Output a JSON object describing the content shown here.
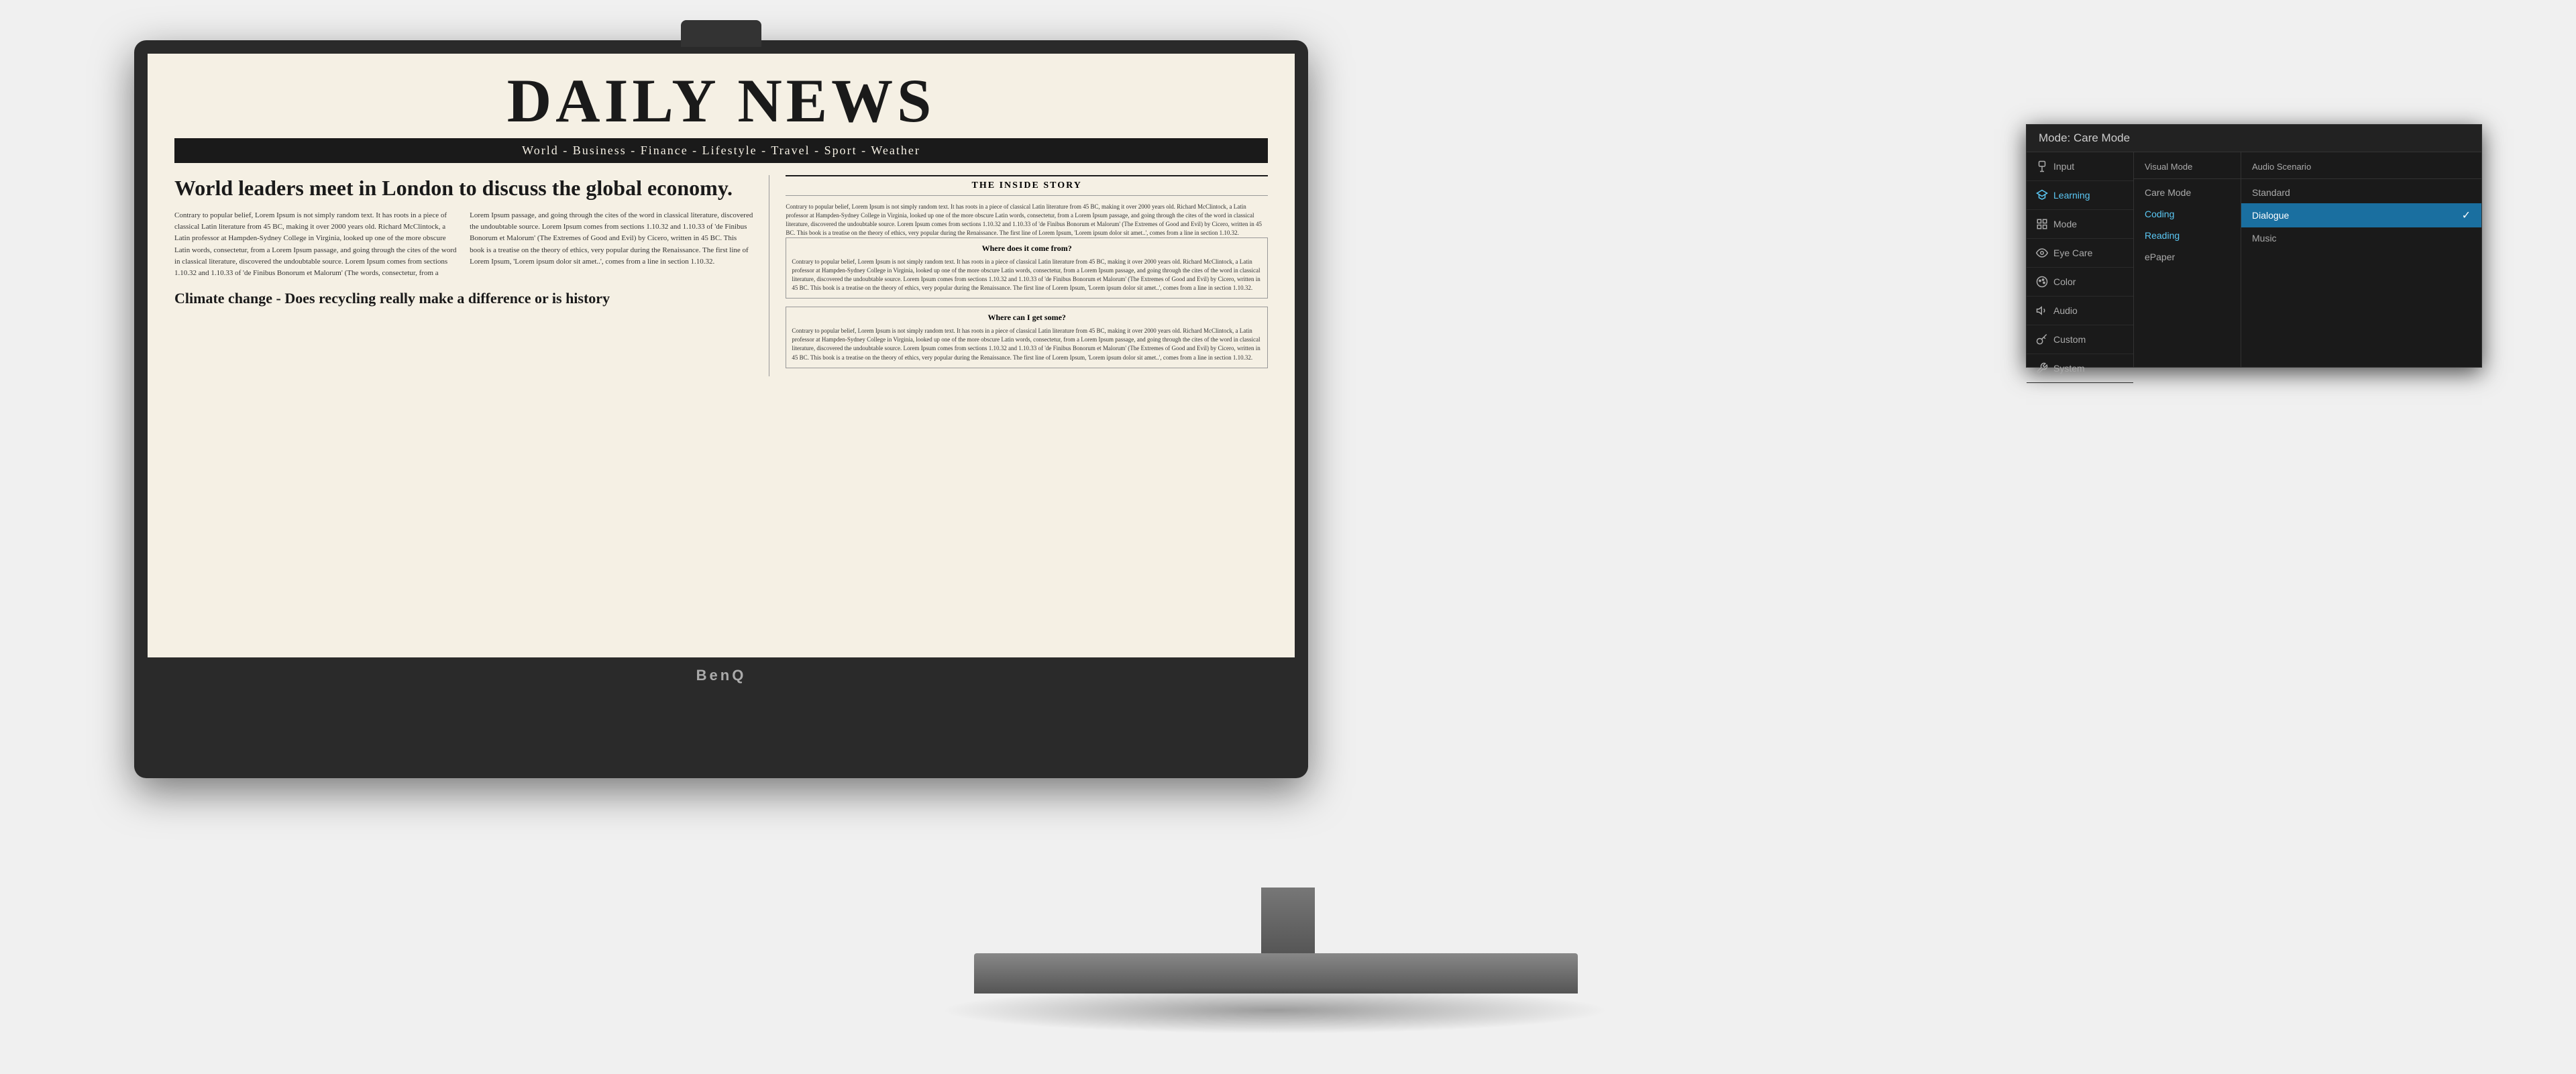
{
  "monitor": {
    "brand": "BenQ"
  },
  "newspaper": {
    "title": "DAILY NEWS",
    "nav": "World - Business - Finance - Lifestyle - Travel - Sport - Weather",
    "headline1": "World leaders meet in London to discuss the global economy.",
    "headline2": "Climate change - Does recycling really make a difference or is history",
    "article1_col1": "Contrary to popular belief, Lorem Ipsum is not simply random text. It has roots in a piece of classical Latin literature from 45 BC, making it over 2000 years old. Richard McClintock, a Latin professor at Hampden-Sydney College in Virginia, looked up one of the more obscure Latin words, consectetur, from a Lorem Ipsum passage, and going through the cites of the word in classical literature, discovered the undoubtable source. Lorem Ipsum comes from sections 1.10.32 and 1.10.33 of 'de Finibus Bonorum et Malorum' (The",
    "article1_col2": "words, consectetur, from a Lorem Ipsum passage, and going through the cites of the word in classical literature, discovered the undoubtable source. Lorem Ipsum comes from sections 1.10.32 and 1.10.33 of 'de Finibus Bonorum et Malorum' (The Extremes of Good and Evil) by Cicero, written in 45 BC. This book is a treatise on the theory of ethics, very popular during the Renaissance. The first line of Lorem Ipsum, 'Lorem ipsum dolor sit amet..', comes from a line in section 1.10.32.",
    "inside_title": "THE INSIDE STORY",
    "inside_intro": "Contrary to popular belief, Lorem Ipsum is not simply random text. It has roots in a piece of classical Latin literature from 45 BC, making it over 2000 years old. Richard McClintock, a Latin professor at Hampden-Sydney College in Virginia, looked up one of the more obscure Latin words, consectetur, from a Lorem Ipsum passage, and going through the cites of the word in classical literature, discovered the undoubtable source. Lorem Ipsum comes from sections 1.10.32 and 1.10.33 of 'de Finibus Bonorum et Malorum' (The Extremes of Good and Evil) by Cicero, written in 45 BC. This book is a treatise on the theory of ethics, very popular during the Renaissance. The first line of Lorem Ipsum, 'Lorem ipsum dolor sit amet..', comes from a line in section 1.10.32.",
    "inside_q1": "Where does it come from?",
    "inside_a1": "Contrary to popular belief, Lorem Ipsum is not simply random text. It has roots in a piece of classical Latin literature from 45 BC, making it over 2000 years old. Richard McClintock, a Latin professor at Hampden-Sydney College in Virginia, looked up one of the more obscure Latin words, consectetur, from a Lorem Ipsum passage, and going through the cites of the word in classical literature, discovered the undoubtable source. Lorem Ipsum comes from sections 1.10.32 and 1.10.33 of 'de Finibus Bonorum et Malorum' (The Extremes of Good and Evil) by Cicero, written in 45 BC. This book is a treatise on the theory of ethics, very popular during the Renaissance. The first line of Lorem Ipsum, 'Lorem ipsum dolor sit amet..', comes from a line in section 1.10.32.",
    "inside_q2": "Where can I get some?",
    "inside_a2": "Contrary to popular belief, Lorem Ipsum is not simply random text. It has roots in a piece of classical Latin literature from 45 BC, making it over 2000 years old. Richard McClintock, a Latin professor at Hampden-Sydney College in Virginia, looked up one of the more obscure Latin words, consectetur, from a Lorem Ipsum passage, and going through the cites of the word in classical literature, discovered the undoubtable source. Lorem Ipsum comes from sections 1.10.32 and 1.10.33 of 'de Finibus Bonorum et Malorum' (The Extremes of Good and Evil) by Cicero, written in 45 BC. This book is a treatise on the theory of ethics, very popular during the Renaissance. The first line of Lorem Ipsum, 'Lorem ipsum dolor sit amet..', comes from a line in section 1.10.32."
  },
  "osd": {
    "header": "Mode: Care Mode",
    "sidebar": [
      {
        "id": "input",
        "label": "Input",
        "icon": "plug"
      },
      {
        "id": "learning",
        "label": "Learning",
        "icon": "graduation",
        "selected": true
      },
      {
        "id": "mode",
        "label": "Mode",
        "icon": "grid"
      },
      {
        "id": "eye-care",
        "label": "Eye Care",
        "icon": "eye"
      },
      {
        "id": "color",
        "label": "Color",
        "icon": "palette"
      },
      {
        "id": "audio",
        "label": "Audio",
        "icon": "speaker"
      },
      {
        "id": "custom",
        "label": "Custom",
        "icon": "key"
      },
      {
        "id": "system",
        "label": "System",
        "icon": "wrench"
      }
    ],
    "col1_title": "Visual Mode",
    "col1_items": [
      {
        "label": "Care Mode",
        "active": false
      },
      {
        "label": "Coding",
        "active": false
      },
      {
        "label": "Reading",
        "active": false,
        "selected_blue": true
      },
      {
        "label": "ePaper",
        "active": false
      }
    ],
    "col2_title": "Audio Scenario",
    "col2_items": [
      {
        "label": "Standard",
        "active": false
      },
      {
        "label": "Dialogue",
        "active": true,
        "checked": true
      },
      {
        "label": "Music",
        "active": false
      }
    ]
  }
}
